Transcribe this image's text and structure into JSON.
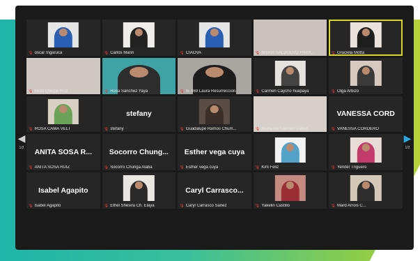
{
  "pager": {
    "left_arrow": "◀",
    "right_arrow": "▶",
    "page_left": "1/2",
    "page_right": "1/2"
  },
  "tiles": [
    {
      "name": "oscar Ingaruca",
      "type": "video",
      "bg": "#e6e6e6",
      "shirt": "#2b5fb3"
    },
    {
      "name": "Carlos Marin",
      "type": "video",
      "bg": "#f0eeea",
      "shirt": "#222222"
    },
    {
      "name": "CIAOVA",
      "type": "video",
      "bg": "#e6e6e6",
      "shirt": "#2b5fb3"
    },
    {
      "name": "MARIA SALDUERO FRAN...",
      "type": "video",
      "bg": "#c9c2bd",
      "shirt": "#c9c2bd",
      "empty": true
    },
    {
      "name": "Graciela Motta",
      "type": "video",
      "bg": "#e9e2dd",
      "shirt": "#1e1e1e",
      "active": true
    },
    {
      "name": "Hilda Quispe Ruiz",
      "type": "video",
      "bg": "#cfc8c3",
      "shirt": "#cfc8c3",
      "empty": true
    },
    {
      "name": "Rosa Sanchez Yaya",
      "type": "video",
      "bg": "#3fa3a6",
      "shirt": "#2d2d2d"
    },
    {
      "name": "IE 469 Laura Resurreccion",
      "type": "video",
      "bg": "#a9a6a2",
      "shirt": "#1d1d1d"
    },
    {
      "name": "Carmen Caycho huapaya",
      "type": "video",
      "bg": "#e6e3df",
      "shirt": "#444444"
    },
    {
      "name": "Olga Arbizo",
      "type": "video",
      "bg": "#d6c9c0",
      "shirt": "#3a3a3a"
    },
    {
      "name": "ROSA CAMA VELT",
      "type": "video",
      "bg": "#d9d0c4",
      "shirt": "#6ba35a"
    },
    {
      "name": "stefany",
      "type": "name",
      "big": "stefany"
    },
    {
      "name": "Guadalupe Ramos Chum...",
      "type": "video",
      "bg": "#5a4d45",
      "shirt": "#3b2f29"
    },
    {
      "name": "María del Carmen Dallez",
      "type": "video",
      "bg": "#d7cfc9",
      "shirt": "#d7cfc9",
      "empty": true
    },
    {
      "name": "VANESSA CORDERO",
      "type": "name",
      "big": "VANESSA CORD"
    },
    {
      "name": "ANITA SOSA RUIZ",
      "type": "name",
      "big": "ANITA SOSA R..."
    },
    {
      "name": "Socorro Chunga Alaba",
      "type": "name",
      "big": "Socorro Chung..."
    },
    {
      "name": "Esther vega cuya",
      "type": "name",
      "big": "Esther vega cuya"
    },
    {
      "name": "Kim Feliz",
      "type": "video",
      "bg": "#f2f2f2",
      "shirt": "#54a2c8"
    },
    {
      "name": "Yenifer Triguero",
      "type": "video",
      "bg": "#e8dcd7",
      "shirt": "#c23b6a"
    },
    {
      "name": "Isabel Agapito",
      "type": "name",
      "big": "Isabel Agapito"
    },
    {
      "name": "Ethel Shesira Ch. Elaya",
      "type": "video",
      "bg": "#eae7e3",
      "shirt": "#2a2a2a"
    },
    {
      "name": "Caryl Carrasco Sanez",
      "type": "name",
      "big": "Caryl Carrasco..."
    },
    {
      "name": "Yakelin Castillo",
      "type": "video",
      "bg": "#c58a82",
      "shirt": "#9a2f35"
    },
    {
      "name": "Mard Arrois C...",
      "type": "video",
      "bg": "#d4c9b8",
      "shirt": "#2e2e2e"
    }
  ]
}
